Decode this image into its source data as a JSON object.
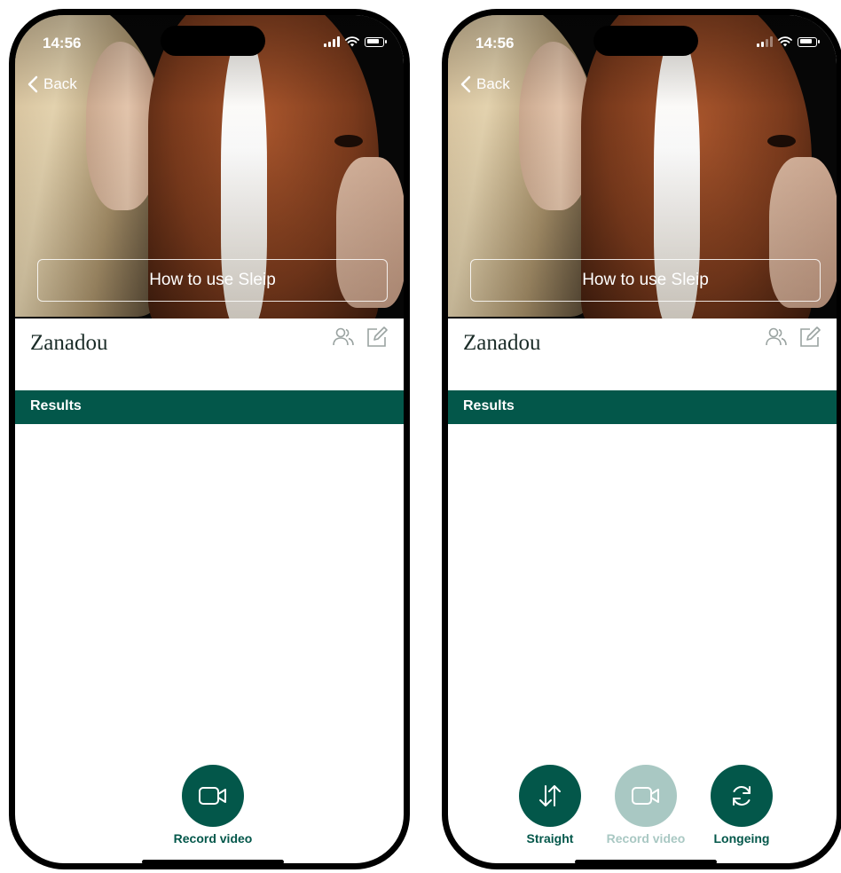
{
  "colors": {
    "brand": "#03574a",
    "brand_disabled": "#a9c8c3"
  },
  "screens": [
    {
      "status": {
        "time": "14:56"
      },
      "nav": {
        "back_label": "Back"
      },
      "hero": {
        "howto_label": "How to use Sleip"
      },
      "horse": {
        "name": "Zanadou",
        "icons": [
          "users-icon",
          "edit-icon"
        ]
      },
      "results": {
        "label": "Results"
      },
      "actions": [
        {
          "label": "Record video",
          "icon": "video-camera-icon",
          "state": "enabled"
        }
      ]
    },
    {
      "status": {
        "time": "14:56"
      },
      "nav": {
        "back_label": "Back"
      },
      "hero": {
        "howto_label": "How to use Sleip"
      },
      "horse": {
        "name": "Zanadou",
        "icons": [
          "users-icon",
          "edit-icon"
        ]
      },
      "results": {
        "label": "Results"
      },
      "actions": [
        {
          "label": "Straight",
          "icon": "swap-vertical-icon",
          "state": "enabled"
        },
        {
          "label": "Record video",
          "icon": "video-camera-icon",
          "state": "disabled"
        },
        {
          "label": "Longeing",
          "icon": "refresh-icon",
          "state": "enabled"
        }
      ]
    }
  ]
}
